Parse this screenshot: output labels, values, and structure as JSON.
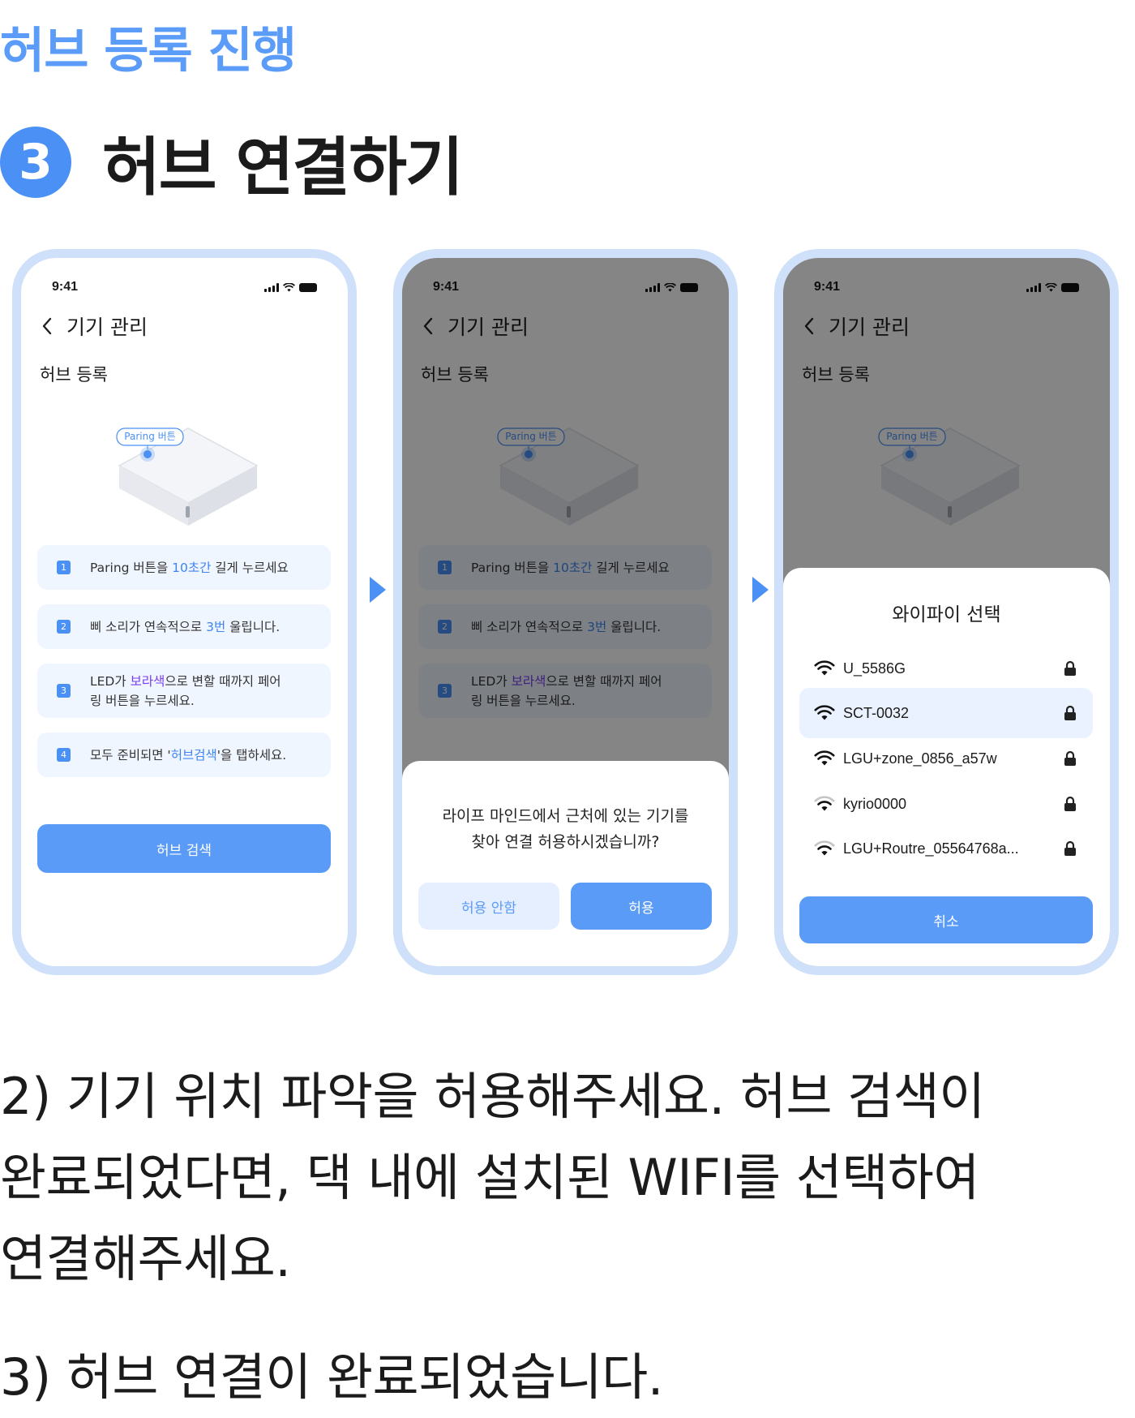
{
  "page": {
    "section_title": "허브 등록 진행",
    "step_number": "3",
    "step_title": "허브 연결하기"
  },
  "phones": {
    "status_time": "9:41",
    "header_title": "기기 관리",
    "sub_title": "허브 등록",
    "device_label": "Paring 버튼"
  },
  "instructions": [
    {
      "num": "1",
      "pre": "Paring 버튼을 ",
      "hl": "10초간",
      "post": " 길게 누르세요"
    },
    {
      "num": "2",
      "pre": "삐 소리가 연속적으로 ",
      "hl": "3번",
      "post": " 울립니다."
    },
    {
      "num": "3",
      "pre": "LED가 ",
      "hl": "보라색",
      "post": "으로 변할 때까지 페어",
      "line2": "링 버튼을 누르세요."
    },
    {
      "num": "4",
      "pre": "모두 준비되면 '",
      "hl": "허브검색",
      "post": "'을 탭하세요."
    }
  ],
  "search_button": "허브 검색",
  "dialog": {
    "line1": "라이프 마인드에서 근처에 있는 기기를",
    "line2": "찾아 연결 허용하시겠습니까?",
    "deny": "허용 안함",
    "allow": "허용"
  },
  "wifi": {
    "title": "와이파이 선택",
    "networks": [
      {
        "name": "U_5586G",
        "signal": "full"
      },
      {
        "name": "SCT-0032",
        "signal": "full",
        "selected": true
      },
      {
        "name": "LGU+zone_0856_a57w",
        "signal": "full"
      },
      {
        "name": "kyrio0000",
        "signal": "weak"
      },
      {
        "name": "LGU+Routre_05564768a...",
        "signal": "weak"
      }
    ],
    "cancel": "취소"
  },
  "body": {
    "para2_line1": "2) 기기 위치 파악을 허용해주세요. 허브 검색이",
    "para2_line2": "완료되었다면, 댁 내에 설치된 WIFI를 선택하여",
    "para2_line3": "연결해주세요.",
    "para3": "3) 허브 연결이 완료되었습니다."
  },
  "colors": {
    "accent": "#4a90f5",
    "button": "#5b9bf8",
    "title": "#5b9cf8",
    "phone_frame": "#cfe0fb",
    "instruction_bg": "#f0f6ff",
    "purple": "#7a3cf0"
  }
}
